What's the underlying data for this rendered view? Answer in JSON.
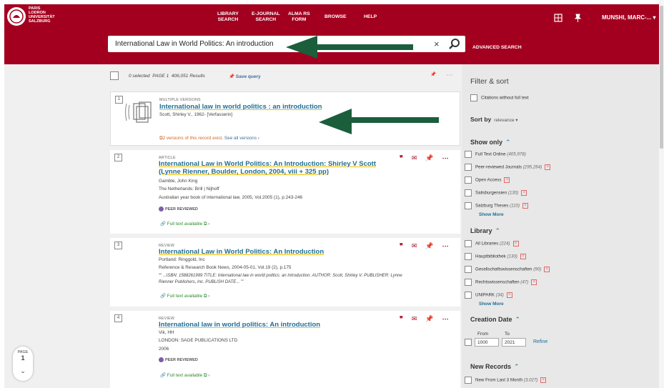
{
  "header": {
    "logo_text": "PARIS\nLODRON\nUNIVERSITÄT\nSALZBURG",
    "nav": [
      {
        "label": "LIBRARY\nSEARCH"
      },
      {
        "label": "E-JOURNAL\nSEARCH"
      },
      {
        "label": "ALMA RS\nFORM"
      },
      {
        "label": "BROWSE"
      },
      {
        "label": "HELP"
      }
    ],
    "user_label": "MUNSHI, MARC-... ▾",
    "brand_color": "#a3001f"
  },
  "search": {
    "query": "International Law in World Politics: An introduction",
    "clear_symbol": "×",
    "advanced_label": "ADVANCED SEARCH"
  },
  "toolbar": {
    "selected": "0 selected",
    "page": "PAGE 1",
    "results": "406,051 Results",
    "save_query": "Save query"
  },
  "results": [
    {
      "num": "1",
      "type": "MULTIPLE VERSIONS",
      "title": "International law in world politics : an introduction",
      "author": "Scott, Shirley V., 1962- [Verfasserin]",
      "versions_text": "2 versions of this record exist.",
      "versions_link": "See all versions ›"
    },
    {
      "num": "2",
      "type": "ARTICLE",
      "title": "International Law in World Politics: An Introduction: Shirley V Scott (Lynne Rienner, Boulder, London, 2004, viii + 325 pp)",
      "author": "Gamble, John King",
      "publisher": "The Netherlands: Brill | Nijhoff",
      "source": "Australian year book of international law, 2005, Vol.2005 (1), p.243-246",
      "peer": "PEER REVIEWED",
      "fulltext": "Full text available ⧉ ›"
    },
    {
      "num": "3",
      "type": "REVIEW",
      "title": "International Law in World Politics: An Introduction",
      "author": "Portland: Ringgold, Inc",
      "source": "Reference & Research Book News, 2004-05-01, Vol.19 (2), p.175",
      "snippet": "““ ...ISBN: 1588261999 TITLE: International law in world politics: an introduction. AUTHOR: Scott, Shirley V. PUBLISHER: Lynne Rienner Publishers, Inc. PUBLISH DATE... ””",
      "fulltext": "Full text available ⧉ ›"
    },
    {
      "num": "4",
      "type": "REVIEW",
      "title": "International law in world politics: An introduction",
      "author": "Vik, HH",
      "publisher": "LONDON: SAGE PUBLICATIONS LTD",
      "year": "2006",
      "peer": "PEER REVIEWED",
      "fulltext": "Full text available ⧉ ›"
    }
  ],
  "sidebar": {
    "title": "Filter & sort",
    "citations": "Citations without full text",
    "sort_label": "Sort by",
    "sort_value": "relevance ▾",
    "show_only": {
      "heading": "Show only",
      "items": [
        {
          "label": "Full Text Online",
          "count": "(405,978)"
        },
        {
          "label": "Peer-reviewed Journals",
          "count": "(295,264)"
        },
        {
          "label": "Open Access",
          "count": ""
        },
        {
          "label": "Salisburgensien",
          "count": "(130)"
        },
        {
          "label": "Salzburg Theses",
          "count": "(110)"
        }
      ],
      "more": "Show More"
    },
    "library": {
      "heading": "Library",
      "items": [
        {
          "label": "All Libraries",
          "count": "(224)"
        },
        {
          "label": "Hauptbibliothek",
          "count": "(130)"
        },
        {
          "label": "Gesellschaftswissenschaften",
          "count": "(90)"
        },
        {
          "label": "Rechtswissenschaften",
          "count": "(47)"
        },
        {
          "label": "UNIPARK",
          "count": "(34)"
        }
      ],
      "more": "Show More"
    },
    "creation_date": {
      "heading": "Creation Date",
      "from_label": "From",
      "to_label": "To",
      "from": "1000",
      "to": "2021",
      "refine": "Refine"
    },
    "new_records": {
      "heading": "New Records",
      "item": "New From Last 3 Month",
      "count": "(3,027)"
    }
  },
  "pager": {
    "label": "PAGE",
    "number": "1"
  }
}
